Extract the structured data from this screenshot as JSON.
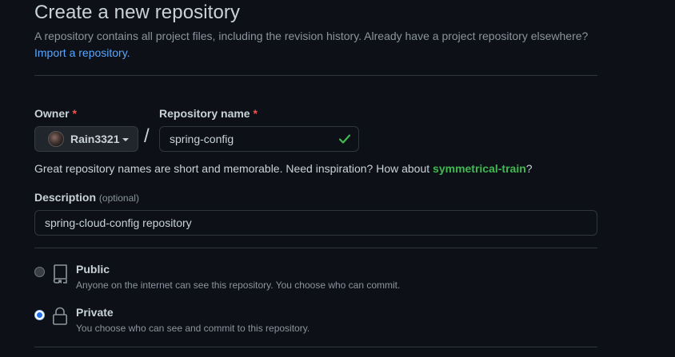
{
  "header": {
    "title": "Create a new repository",
    "subtitle": "A repository contains all project files, including the revision history. Already have a project repository elsewhere?",
    "import_link": "Import a repository."
  },
  "owner": {
    "label": "Owner",
    "required_mark": "*",
    "value": "Rain3321",
    "icon": "avatar"
  },
  "separator": "/",
  "repo_name": {
    "label": "Repository name",
    "required_mark": "*",
    "value": "spring-config",
    "status_icon": "check-icon",
    "status_color": "#3fb950"
  },
  "name_hint": {
    "text": "Great repository names are short and memorable. Need inspiration? How about ",
    "suggestion": "symmetrical-train",
    "suffix": "?"
  },
  "description": {
    "label": "Description",
    "optional": "(optional)",
    "value": "spring-cloud-config repository"
  },
  "visibility": {
    "selected": "private",
    "options": [
      {
        "id": "public",
        "title": "Public",
        "description": "Anyone on the internet can see this repository. You choose who can commit.",
        "icon": "repo-icon"
      },
      {
        "id": "private",
        "title": "Private",
        "description": "You choose who can see and commit to this repository.",
        "icon": "lock-icon"
      }
    ]
  },
  "colors": {
    "background": "#0d1117",
    "link": "#58a6ff",
    "required": "#f85149",
    "success": "#3fb950",
    "accent": "#1f6feb"
  }
}
